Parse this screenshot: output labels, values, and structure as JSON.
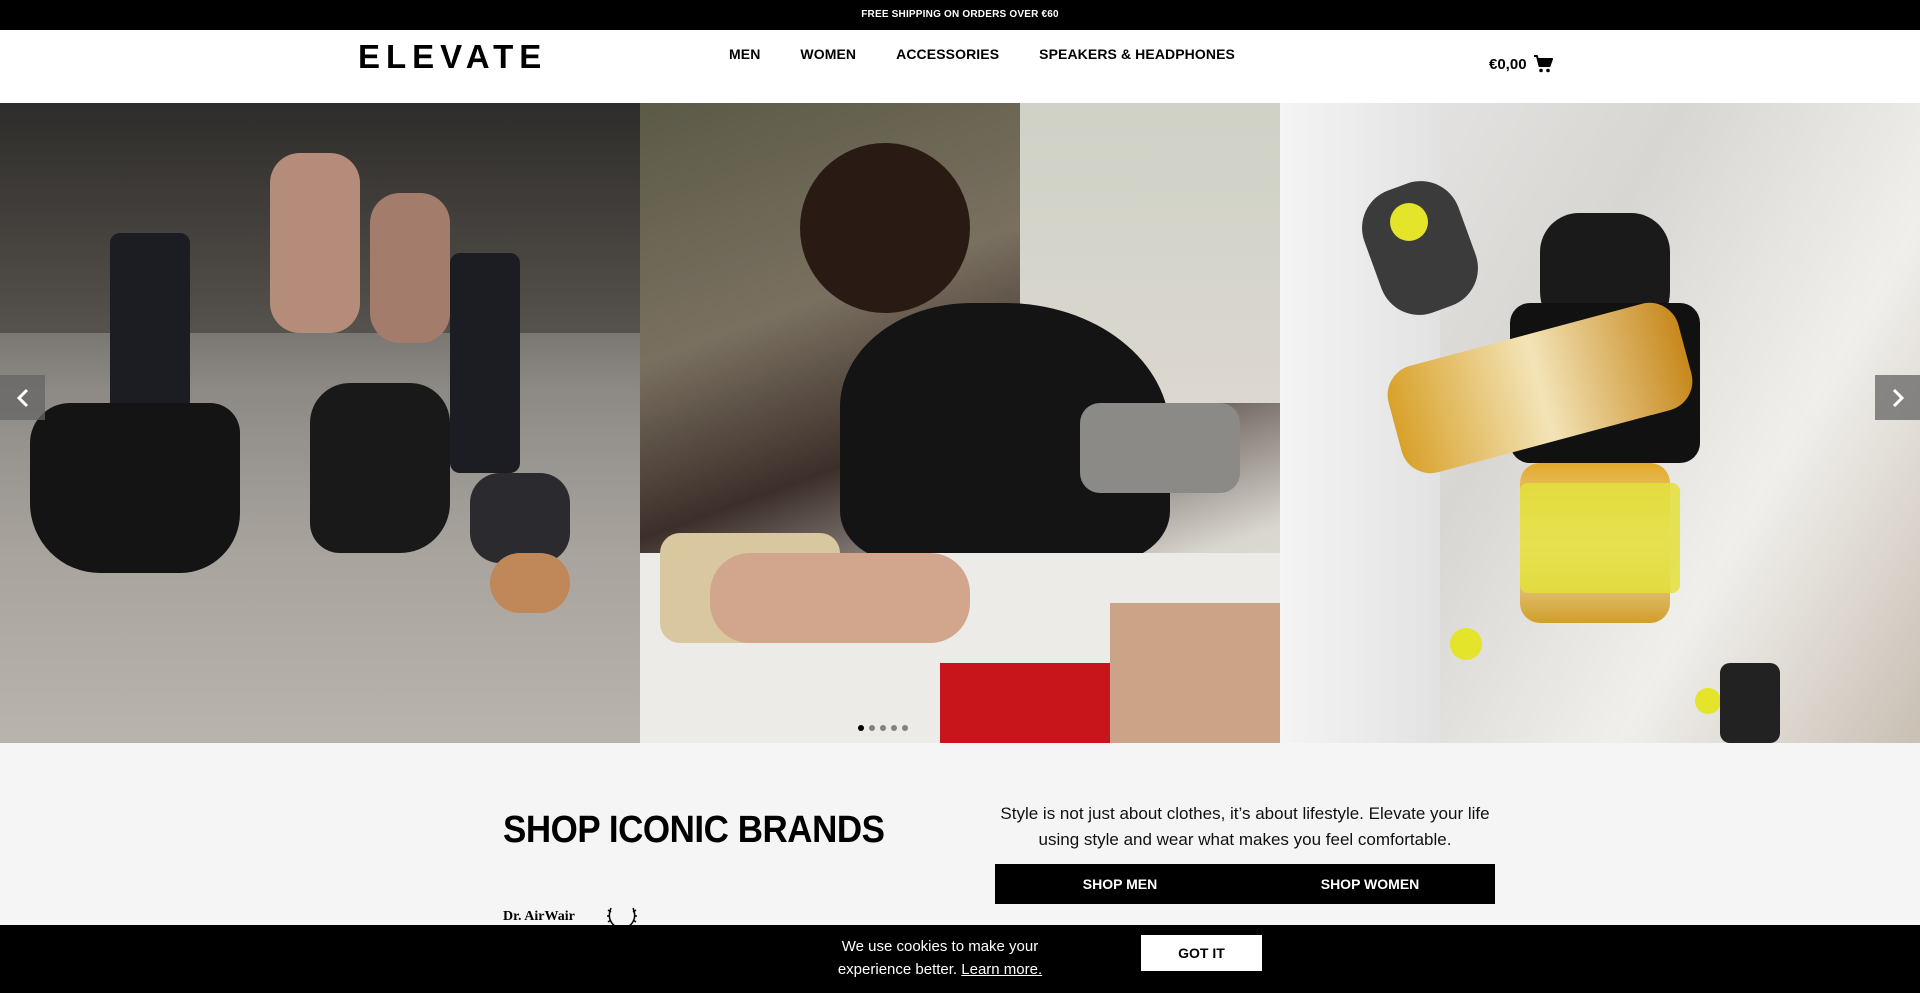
{
  "topbar": {
    "text": "FREE SHIPPING ON ORDERS OVER €60"
  },
  "header": {
    "logo": "ELEVATE",
    "nav": [
      "MEN",
      "WOMEN",
      "ACCESSORIES",
      "SPEAKERS & HEADPHONES"
    ],
    "cart_total": "€0,00"
  },
  "hero": {
    "slides_count": 3,
    "active_slide": 1
  },
  "brands_section": {
    "title": "SHOP ICONIC BRANDS",
    "tagline": "Style is not just about clothes, it’s about lifestyle. Elevate your life using style and wear what makes you feel comfortable.",
    "shop_men": "SHOP MEN",
    "shop_women": "SHOP WOMEN",
    "brand_logo_1": "Dr. AirWair"
  },
  "cookie_banner": {
    "text": "We use cookies to make your experience better.",
    "link": "Learn more.",
    "button": "GOT IT"
  },
  "colors": {
    "primary": "#000000",
    "background": "#f5f5f5",
    "white": "#ffffff"
  }
}
